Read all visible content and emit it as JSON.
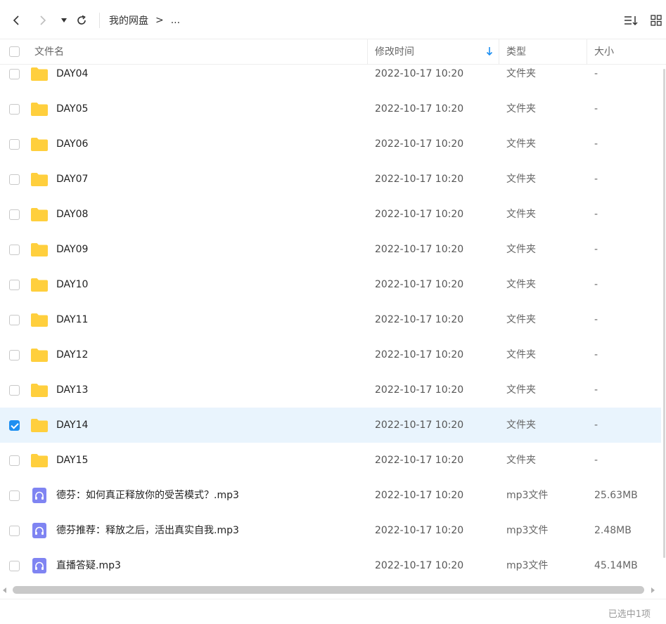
{
  "toolbar": {
    "breadcrumb_root": "我的网盘",
    "breadcrumb_separator": ">",
    "breadcrumb_more": "..."
  },
  "columns": {
    "name": "文件名",
    "modified": "修改时间",
    "type": "类型",
    "size": "大小"
  },
  "sort": {
    "column": "modified",
    "direction": "desc"
  },
  "colors": {
    "accent": "#1e8ff1",
    "folder": "#ffcf3d",
    "audio": "#7f84f2",
    "selected_row": "#e9f4fd"
  },
  "files": [
    {
      "name": "DAY04",
      "modified": "2022-10-17 10:20",
      "type": "文件夹",
      "size": "-",
      "icon": "folder-icon",
      "checked": false
    },
    {
      "name": "DAY05",
      "modified": "2022-10-17 10:20",
      "type": "文件夹",
      "size": "-",
      "icon": "folder-icon",
      "checked": false
    },
    {
      "name": "DAY06",
      "modified": "2022-10-17 10:20",
      "type": "文件夹",
      "size": "-",
      "icon": "folder-icon",
      "checked": false
    },
    {
      "name": "DAY07",
      "modified": "2022-10-17 10:20",
      "type": "文件夹",
      "size": "-",
      "icon": "folder-icon",
      "checked": false
    },
    {
      "name": "DAY08",
      "modified": "2022-10-17 10:20",
      "type": "文件夹",
      "size": "-",
      "icon": "folder-icon",
      "checked": false
    },
    {
      "name": "DAY09",
      "modified": "2022-10-17 10:20",
      "type": "文件夹",
      "size": "-",
      "icon": "folder-icon",
      "checked": false
    },
    {
      "name": "DAY10",
      "modified": "2022-10-17 10:20",
      "type": "文件夹",
      "size": "-",
      "icon": "folder-icon",
      "checked": false
    },
    {
      "name": "DAY11",
      "modified": "2022-10-17 10:20",
      "type": "文件夹",
      "size": "-",
      "icon": "folder-icon",
      "checked": false
    },
    {
      "name": "DAY12",
      "modified": "2022-10-17 10:20",
      "type": "文件夹",
      "size": "-",
      "icon": "folder-icon",
      "checked": false
    },
    {
      "name": "DAY13",
      "modified": "2022-10-17 10:20",
      "type": "文件夹",
      "size": "-",
      "icon": "folder-icon",
      "checked": false
    },
    {
      "name": "DAY14",
      "modified": "2022-10-17 10:20",
      "type": "文件夹",
      "size": "-",
      "icon": "folder-icon",
      "checked": true
    },
    {
      "name": "DAY15",
      "modified": "2022-10-17 10:20",
      "type": "文件夹",
      "size": "-",
      "icon": "folder-icon",
      "checked": false
    },
    {
      "name": "德芬：如何真正释放你的受苦模式？.mp3",
      "modified": "2022-10-17 10:20",
      "type": "mp3文件",
      "size": "25.63MB",
      "icon": "audio-file-icon",
      "checked": false
    },
    {
      "name": "德芬推荐：释放之后，活出真实自我.mp3",
      "modified": "2022-10-17 10:20",
      "type": "mp3文件",
      "size": "2.48MB",
      "icon": "audio-file-icon",
      "checked": false
    },
    {
      "name": "直播答疑.mp3",
      "modified": "2022-10-17 10:20",
      "type": "mp3文件",
      "size": "45.14MB",
      "icon": "audio-file-icon",
      "checked": false
    }
  ],
  "status": {
    "selection": "已选中1项"
  }
}
